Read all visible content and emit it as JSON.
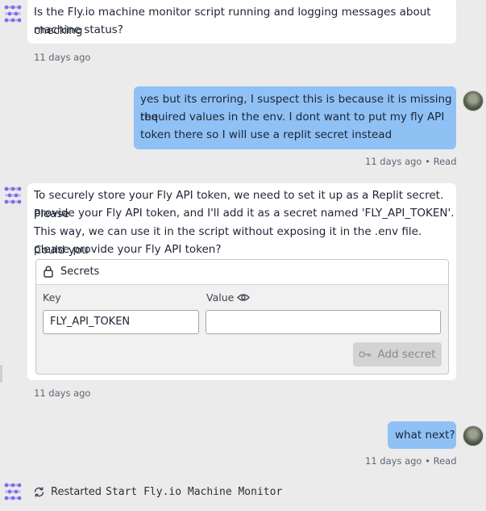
{
  "messages": [
    {
      "role": "assistant",
      "text_line1": "Is the Fly.io machine monitor script running and logging messages about checking",
      "text_line2": "machine status?",
      "meta": "11 days ago"
    },
    {
      "role": "user",
      "line1": "yes but its erroring, I suspect this is because it is missing the",
      "line2": "required values in the env. I dont want to put my fly API",
      "line3": "token there so I will use a replit secret instead",
      "meta_time": "11 days ago",
      "meta_sep": "•",
      "meta_status": "Read"
    },
    {
      "role": "assistant",
      "line1": "To securely store your Fly API token, we need to set it up as a Replit secret. Please",
      "line2": "provide your Fly API token, and I'll add it as a secret named 'FLY_API_TOKEN'.",
      "line3": "This way, we can use it in the script without exposing it in the .env file. Could you",
      "line4": "please provide your Fly API token?",
      "meta": "11 days ago"
    },
    {
      "role": "user",
      "text": "what next?",
      "meta_time": "11 days ago",
      "meta_sep": "•",
      "meta_status": "Read"
    }
  ],
  "secrets_widget": {
    "title": "Secrets",
    "key_label": "Key",
    "value_label": "Value",
    "key_value": "FLY_API_TOKEN",
    "value_value": "",
    "add_label": "Add secret"
  },
  "status_line": {
    "prefix": "Restarted",
    "workflow": "Start Fly.io Machine Monitor"
  },
  "colors": {
    "ai_logo": "#7b6cf0",
    "user_bubble": "#8fc1f5",
    "background": "#ebebeb"
  }
}
